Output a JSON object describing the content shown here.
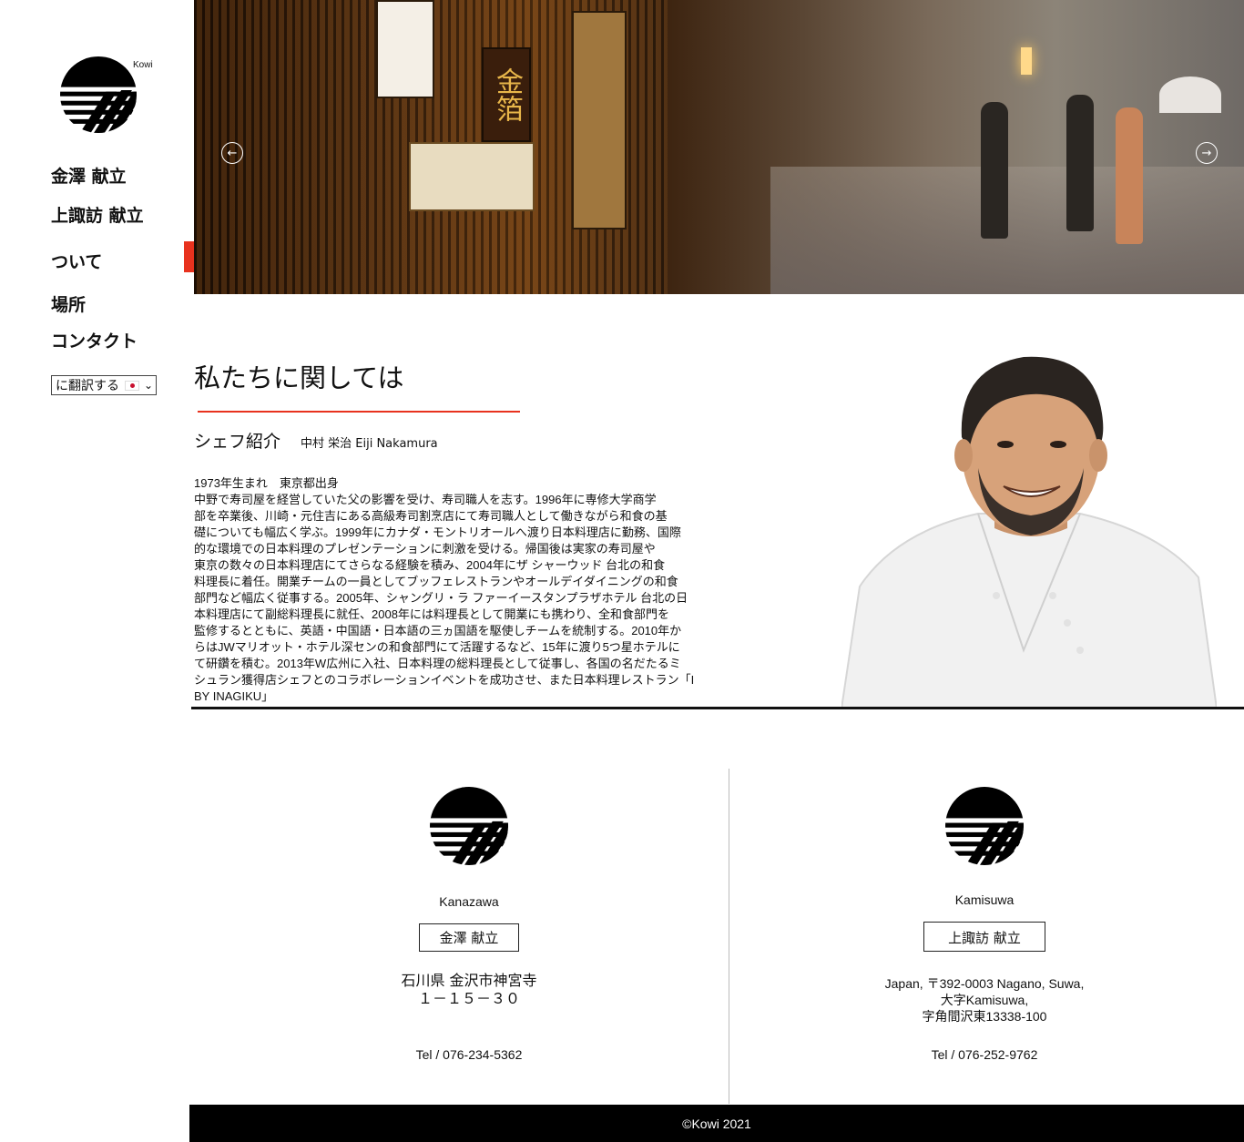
{
  "brand": {
    "name": "Kowi"
  },
  "nav": {
    "items": [
      {
        "label": "金澤 献立"
      },
      {
        "label": "上諏訪 献立"
      },
      {
        "label": "ついて"
      },
      {
        "label": "場所"
      },
      {
        "label": "コンタクト"
      }
    ],
    "active_index": 2
  },
  "translate": {
    "label": "に翻訳する"
  },
  "hero": {
    "prev": "←",
    "next": "→",
    "sign_text": "金箔"
  },
  "about": {
    "title": "私たちに関しては",
    "chef_label": "シェフ紹介",
    "chef_name": "中村 栄治 Eiji Nakamura",
    "bio_lines": [
      "1973年生まれ　東京都出身",
      "中野で寿司屋を経営していた父の影響を受け、寿司職人を志す。1996年に専修大学商学",
      "部を卒業後、川崎・元住吉にある高級寿司割烹店にて寿司職人として働きながら和食の基",
      "礎についても幅広く学ぶ。1999年にカナダ・モントリオールへ渡り日本料理店に勤務、国際",
      "的な環境での日本料理のプレゼンテーションに刺激を受ける。帰国後は実家の寿司屋や",
      "東京の数々の日本料理店にてさらなる経験を積み、2004年にザ シャーウッド 台北の和食",
      "料理長に着任。開業チームの一員としてブッフェレストランやオールデイダイニングの和食",
      "部門など幅広く従事する。2005年、シャングリ・ラ ファーイースタンプラザホテル 台北の日",
      "本料理店にて副総料理長に就任、2008年には料理長として開業にも携わり、全和食部門を",
      "監修するとともに、英語・中国語・日本語の三ヵ国語を駆使しチームを統制する。2010年か",
      "らはJWマリオット・ホテル深センの和食部門にて活躍するなど、15年に渡り5つ星ホテルに",
      "て研鑽を積む。2013年W広州に入社、日本料理の総料理長として従事し、各国の名だたるミ",
      "シュラン獲得店シェフとのコラボレーションイベントを成功させ、また日本料理レストラン「I",
      "BY INAGIKU」"
    ]
  },
  "locations": [
    {
      "name": "Kanazawa",
      "button": "金澤 献立",
      "address_lines": [
        "石川県 金沢市神宮寺",
        "１－１５－３０"
      ],
      "tel": "Tel / 076-234-5362"
    },
    {
      "name": "Kamisuwa",
      "button": "上諏訪 献立",
      "address_lines": [
        "Japan, 〒392-0003 Nagano, Suwa,",
        "大字Kamisuwa,",
        "字角間沢東13338-100"
      ],
      "tel": "Tel / 076-252-9762"
    }
  ],
  "footer": {
    "copyright": "©Kowi 2021"
  }
}
